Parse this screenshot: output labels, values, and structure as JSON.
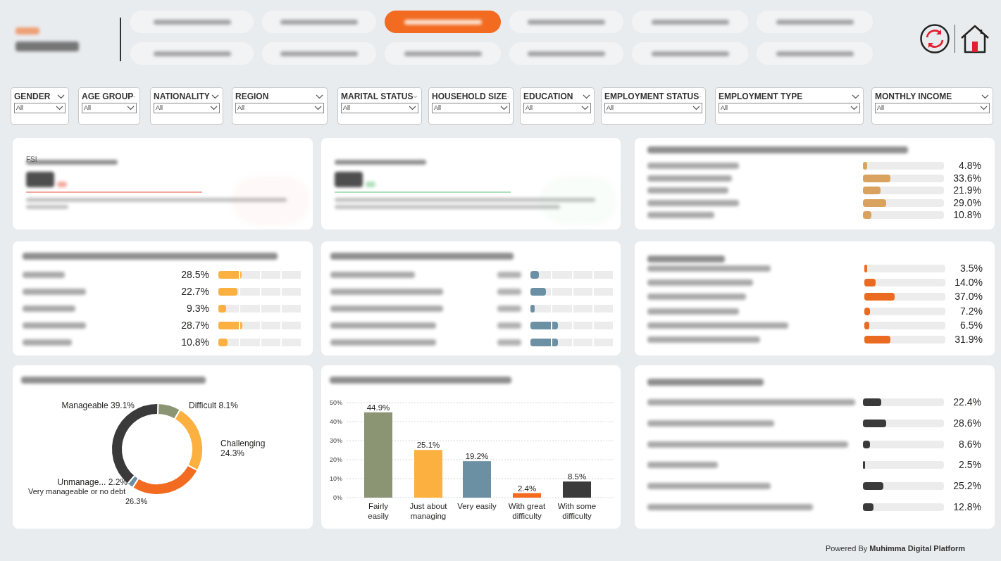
{
  "header": {
    "nav_rows": [
      [
        {
          "selected": false
        },
        {
          "selected": false
        },
        {
          "selected": true
        },
        {
          "selected": false
        },
        {
          "selected": false
        },
        {
          "selected": false
        }
      ],
      [
        {
          "selected": false
        },
        {
          "selected": false
        },
        {
          "selected": false
        },
        {
          "selected": false
        },
        {
          "selected": false
        },
        {
          "selected": false
        }
      ]
    ]
  },
  "filters": [
    {
      "label": "GENDER",
      "value": "All"
    },
    {
      "label": "AGE GROUP",
      "value": "All"
    },
    {
      "label": "NATIONALITY",
      "value": "All"
    },
    {
      "label": "REGION",
      "value": "All"
    },
    {
      "label": "MARITAL STATUS",
      "value": "All"
    },
    {
      "label": "HOUSEHOLD SIZE",
      "value": "All"
    },
    {
      "label": "EDUCATION",
      "value": "All"
    },
    {
      "label": "EMPLOYMENT STATUS",
      "value": "All"
    },
    {
      "label": "EMPLOYMENT TYPE",
      "value": "All"
    },
    {
      "label": "MONTHLY INCOME",
      "value": "All"
    }
  ],
  "kpi_cards": [
    {
      "tag": "FSI",
      "color": "#f5a99f"
    },
    {
      "color": "#aee0bb"
    }
  ],
  "affordability": {
    "rows": [
      {
        "value": "4.8%",
        "level": 0.048
      },
      {
        "value": "33.6%",
        "level": 0.336
      },
      {
        "value": "21.9%",
        "level": 0.219
      },
      {
        "value": "29.0%",
        "level": 0.29
      },
      {
        "value": "10.8%",
        "level": 0.108
      }
    ]
  },
  "survival": {
    "rows": [
      {
        "value": "28.5%",
        "level": 0.285
      },
      {
        "value": "22.7%",
        "level": 0.227
      },
      {
        "value": "9.3%",
        "level": 0.093
      },
      {
        "value": "28.7%",
        "level": 0.287
      },
      {
        "value": "10.8%",
        "level": 0.108
      }
    ]
  },
  "savings": {
    "rows": [
      {
        "level": 0.1
      },
      {
        "level": 0.19
      },
      {
        "level": 0.05
      },
      {
        "level": 0.33
      },
      {
        "level": 0.33
      }
    ]
  },
  "housing": {
    "rows": [
      {
        "value": "3.5%",
        "level": 0.035
      },
      {
        "value": "14.0%",
        "level": 0.14
      },
      {
        "value": "37.0%",
        "level": 0.37
      },
      {
        "value": "7.2%",
        "level": 0.072
      },
      {
        "value": "6.5%",
        "level": 0.065
      },
      {
        "value": "31.9%",
        "level": 0.319
      }
    ]
  },
  "debt": {
    "chart_data": {
      "type": "donut",
      "categories": [
        "Difficult",
        "Challenging",
        "Very manageable or no debt",
        "Unmanage...",
        "Manageable"
      ],
      "values": [
        8.1,
        24.3,
        26.3,
        2.2,
        39.1
      ],
      "value_labels": [
        "8.1%",
        "24.3%",
        "26.3%",
        "2.2%",
        "39.1%"
      ],
      "colors": [
        "#8b9574",
        "#fbb040",
        "#f26b21",
        "#6b8fa3",
        "#3a3a3a"
      ]
    }
  },
  "income_sufficiency": {
    "chart_data": {
      "type": "bar",
      "categories": [
        "Fairly\neasily",
        "Just about\nmanaging",
        "Very easily",
        "With great\ndifficulty",
        "With some\ndifficulty"
      ],
      "values": [
        44.9,
        25.1,
        19.2,
        2.4,
        8.5
      ],
      "value_labels": [
        "44.9%",
        "25.1%",
        "19.2%",
        "2.4%",
        "8.5%"
      ],
      "colors": [
        "#8b9574",
        "#fbb040",
        "#6b8fa3",
        "#f26b21",
        "#3a3a3a"
      ],
      "grid": true,
      "ylim": [
        0,
        50
      ],
      "yticks": [
        {
          "value": 0,
          "label": "0%"
        },
        {
          "value": 10,
          "label": "10%"
        },
        {
          "value": 20,
          "label": "20%"
        },
        {
          "value": 30,
          "label": "30%"
        },
        {
          "value": 40,
          "label": "40%"
        },
        {
          "value": 50,
          "label": "50%"
        }
      ]
    }
  },
  "income_diversification": {
    "rows": [
      {
        "value": "22.4%",
        "level": 0.224
      },
      {
        "value": "28.6%",
        "level": 0.286
      },
      {
        "value": "8.6%",
        "level": 0.086
      },
      {
        "value": "2.5%",
        "level": 0.025
      },
      {
        "value": "25.2%",
        "level": 0.252
      },
      {
        "value": "12.8%",
        "level": 0.128
      }
    ]
  },
  "footer": "Powered By **Muhimma Digital Platform**"
}
